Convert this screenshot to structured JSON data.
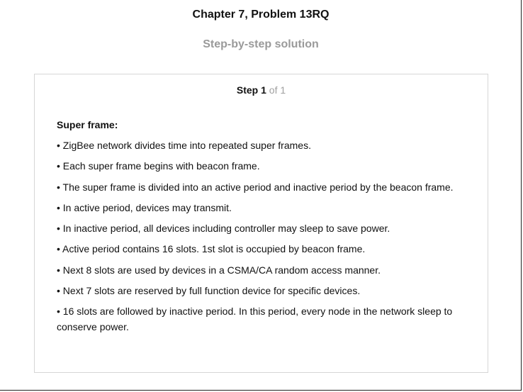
{
  "header": {
    "chapter_title": "Chapter 7, Problem 13RQ",
    "subtitle": "Step-by-step solution"
  },
  "step": {
    "label": "Step",
    "number": "1",
    "total_text": "of 1",
    "heading": "Super frame:",
    "bullets": [
      "• ZigBee network divides time into repeated super frames.",
      "• Each super frame begins with beacon frame.",
      "• The super frame is divided into an active period and inactive period by the beacon frame.",
      "• In active period, devices may transmit.",
      "• In inactive period, all devices including controller may sleep to save power.",
      "• Active period contains 16 slots. 1st slot is occupied by beacon frame.",
      "• Next 8 slots are used by devices in a CSMA/CA random access manner.",
      "• Next 7 slots are reserved by full function device for specific devices.",
      "• 16 slots are followed by inactive period. In this period, every node in the network sleep to conserve power."
    ]
  }
}
